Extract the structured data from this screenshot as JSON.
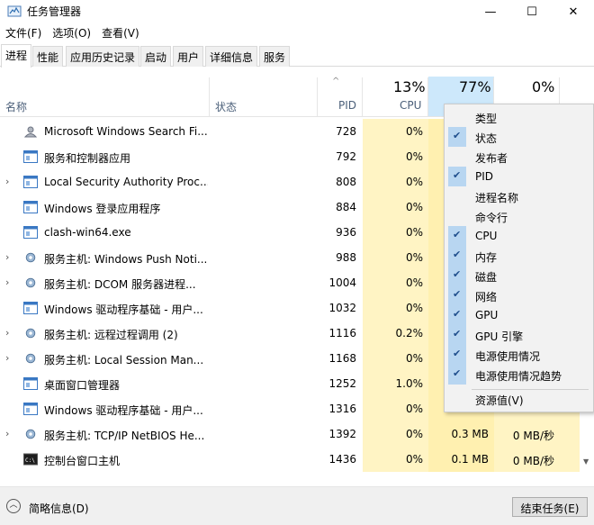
{
  "window": {
    "title": "任务管理器",
    "minimize": "—",
    "maximize": "☐",
    "close": "✕"
  },
  "menu": [
    "文件(F)",
    "选项(O)",
    "查看(V)"
  ],
  "tabs": [
    "进程",
    "性能",
    "应用历史记录",
    "启动",
    "用户",
    "详细信息",
    "服务"
  ],
  "header": {
    "name": "名称",
    "status": "状态",
    "pid": "PID",
    "cpu": "CPU",
    "cpu_pct": "13%",
    "mem_pct": "77%",
    "disk_pct": "0%",
    "sort_indicator": "^"
  },
  "processes": [
    {
      "name": "Microsoft Windows Search Fi...",
      "pid": "728",
      "cpu": "0%",
      "mem": "",
      "disk": "",
      "expand": false,
      "icon": "search-user-icon"
    },
    {
      "name": "服务和控制器应用",
      "pid": "792",
      "cpu": "0%",
      "mem": "",
      "disk": "",
      "expand": false,
      "icon": "window-app-icon"
    },
    {
      "name": "Local Security Authority Proc...",
      "pid": "808",
      "cpu": "0%",
      "mem": "",
      "disk": "",
      "expand": true,
      "icon": "window-app-icon"
    },
    {
      "name": "Windows 登录应用程序",
      "pid": "884",
      "cpu": "0%",
      "mem": "",
      "disk": "",
      "expand": false,
      "icon": "window-app-icon"
    },
    {
      "name": "clash-win64.exe",
      "pid": "936",
      "cpu": "0%",
      "mem": "",
      "disk": "",
      "expand": false,
      "icon": "window-app-icon"
    },
    {
      "name": "服务主机: Windows Push Noti...",
      "pid": "988",
      "cpu": "0%",
      "mem": "",
      "disk": "",
      "expand": true,
      "icon": "gear-icon"
    },
    {
      "name": "服务主机: DCOM 服务器进程...",
      "pid": "1004",
      "cpu": "0%",
      "mem": "",
      "disk": "",
      "expand": true,
      "icon": "gear-icon"
    },
    {
      "name": "Windows 驱动程序基础 - 用户...",
      "pid": "1032",
      "cpu": "0%",
      "mem": "",
      "disk": "",
      "expand": false,
      "icon": "window-app-icon"
    },
    {
      "name": "服务主机: 远程过程调用 (2)",
      "pid": "1116",
      "cpu": "0.2%",
      "mem": "",
      "disk": "",
      "expand": true,
      "icon": "gear-icon"
    },
    {
      "name": "服务主机: Local Session Man...",
      "pid": "1168",
      "cpu": "0%",
      "mem": "",
      "disk": "",
      "expand": true,
      "icon": "gear-icon"
    },
    {
      "name": "桌面窗口管理器",
      "pid": "1252",
      "cpu": "1.0%",
      "mem": "",
      "disk": "",
      "expand": false,
      "icon": "window-app-icon"
    },
    {
      "name": "Windows 驱动程序基础 - 用户...",
      "pid": "1316",
      "cpu": "0%",
      "mem": "",
      "disk": "",
      "expand": false,
      "icon": "window-app-icon"
    },
    {
      "name": "服务主机: TCP/IP NetBIOS He...",
      "pid": "1392",
      "cpu": "0%",
      "mem": "0.3 MB",
      "disk": "0 MB/秒",
      "expand": true,
      "icon": "gear-icon"
    },
    {
      "name": "控制台窗口主机",
      "pid": "1436",
      "cpu": "0%",
      "mem": "0.1 MB",
      "disk": "0 MB/秒",
      "expand": false,
      "icon": "console-icon"
    }
  ],
  "context_menu": [
    {
      "label": "类型",
      "checked": false
    },
    {
      "label": "状态",
      "checked": true
    },
    {
      "label": "发布者",
      "checked": false
    },
    {
      "label": "PID",
      "checked": true
    },
    {
      "label": "进程名称",
      "checked": false
    },
    {
      "label": "命令行",
      "checked": false
    },
    {
      "label": "CPU",
      "checked": true
    },
    {
      "label": "内存",
      "checked": true
    },
    {
      "label": "磁盘",
      "checked": true
    },
    {
      "label": "网络",
      "checked": true
    },
    {
      "label": "GPU",
      "checked": true
    },
    {
      "label": "GPU 引擎",
      "checked": true
    },
    {
      "label": "电源使用情况",
      "checked": true
    },
    {
      "label": "电源使用情况趋势",
      "checked": true
    }
  ],
  "context_menu_footer": "资源值(V)",
  "footer": {
    "brief": "简略信息(D)",
    "end_task": "结束任务(E)"
  }
}
